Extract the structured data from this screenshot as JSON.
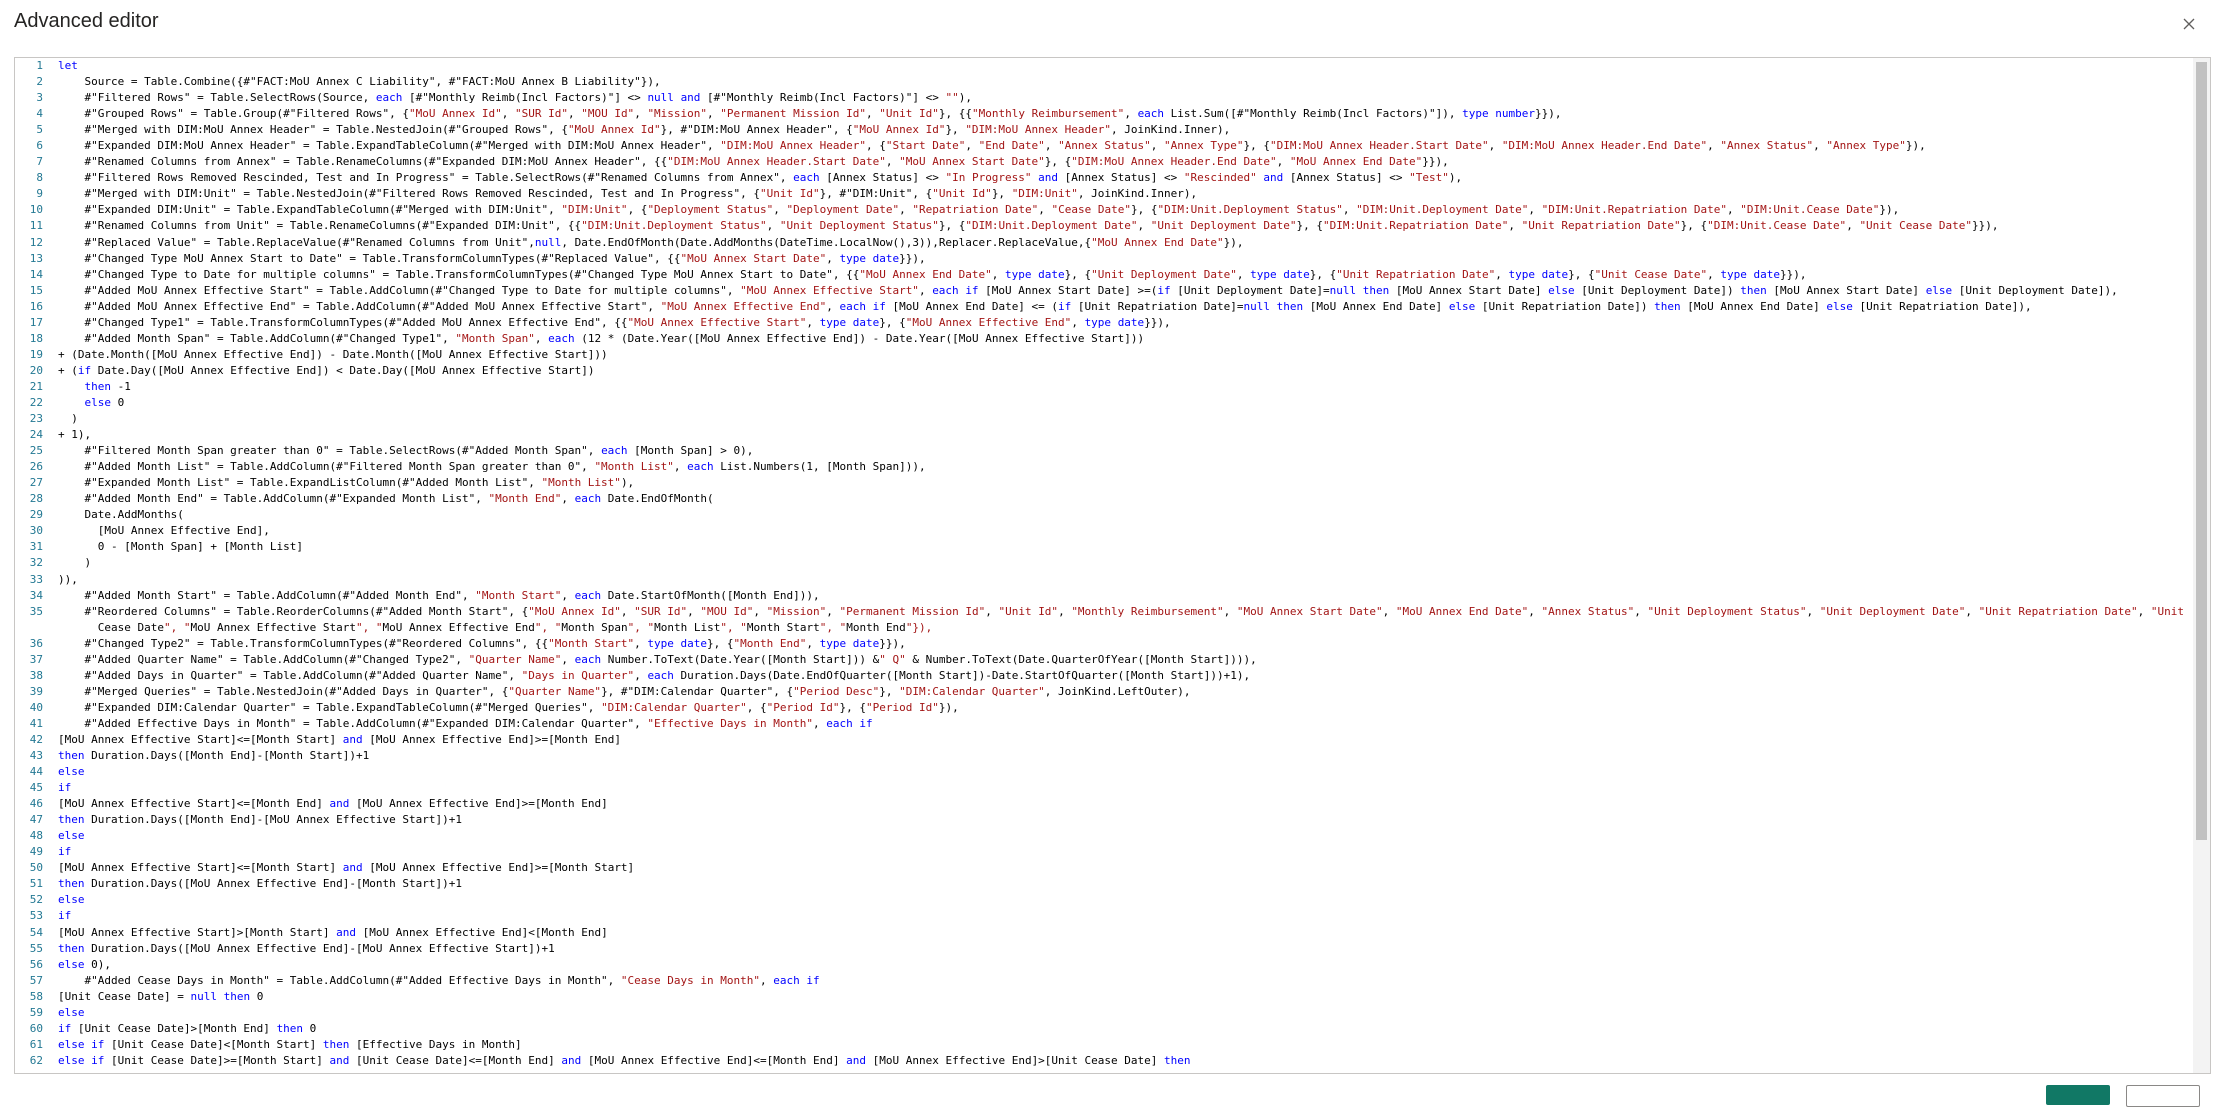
{
  "title": "Advanced editor",
  "icons": {
    "close": "close-icon"
  },
  "colors": {
    "keyword": "#0000ff",
    "string": "#a31515",
    "line_number": "#237893",
    "accent": "#117865"
  },
  "buttons": {
    "done_label": "",
    "cancel_label": ""
  },
  "editor": {
    "lines": [
      "let",
      "    Source = Table.Combine({#\"FACT:MoU Annex C Liability\", #\"FACT:MoU Annex B Liability\"}),",
      "    #\"Filtered Rows\" = Table.SelectRows(Source, each [#\"Monthly Reimb(Incl Factors)\"] <> null and [#\"Monthly Reimb(Incl Factors)\"] <> \"\"),",
      "    #\"Grouped Rows\" = Table.Group(#\"Filtered Rows\", {\"MoU Annex Id\", \"SUR Id\", \"MOU Id\", \"Mission\", \"Permanent Mission Id\", \"Unit Id\"}, {{\"Monthly Reimbursement\", each List.Sum([#\"Monthly Reimb(Incl Factors)\"]), type number}}),",
      "    #\"Merged with DIM:MoU Annex Header\" = Table.NestedJoin(#\"Grouped Rows\", {\"MoU Annex Id\"}, #\"DIM:MoU Annex Header\", {\"MoU Annex Id\"}, \"DIM:MoU Annex Header\", JoinKind.Inner),",
      "    #\"Expanded DIM:MoU Annex Header\" = Table.ExpandTableColumn(#\"Merged with DIM:MoU Annex Header\", \"DIM:MoU Annex Header\", {\"Start Date\", \"End Date\", \"Annex Status\", \"Annex Type\"}, {\"DIM:MoU Annex Header.Start Date\", \"DIM:MoU Annex Header.End Date\", \"Annex Status\", \"Annex Type\"}),",
      "    #\"Renamed Columns from Annex\" = Table.RenameColumns(#\"Expanded DIM:MoU Annex Header\", {{\"DIM:MoU Annex Header.Start Date\", \"MoU Annex Start Date\"}, {\"DIM:MoU Annex Header.End Date\", \"MoU Annex End Date\"}}),",
      "    #\"Filtered Rows Removed Rescinded, Test and In Progress\" = Table.SelectRows(#\"Renamed Columns from Annex\", each [Annex Status] <> \"In Progress\" and [Annex Status] <> \"Rescinded\" and [Annex Status] <> \"Test\"),",
      "    #\"Merged with DIM:Unit\" = Table.NestedJoin(#\"Filtered Rows Removed Rescinded, Test and In Progress\", {\"Unit Id\"}, #\"DIM:Unit\", {\"Unit Id\"}, \"DIM:Unit\", JoinKind.Inner),",
      "    #\"Expanded DIM:Unit\" = Table.ExpandTableColumn(#\"Merged with DIM:Unit\", \"DIM:Unit\", {\"Deployment Status\", \"Deployment Date\", \"Repatriation Date\", \"Cease Date\"}, {\"DIM:Unit.Deployment Status\", \"DIM:Unit.Deployment Date\", \"DIM:Unit.Repatriation Date\", \"DIM:Unit.Cease Date\"}),",
      "    #\"Renamed Columns from Unit\" = Table.RenameColumns(#\"Expanded DIM:Unit\", {{\"DIM:Unit.Deployment Status\", \"Unit Deployment Status\"}, {\"DIM:Unit.Deployment Date\", \"Unit Deployment Date\"}, {\"DIM:Unit.Repatriation Date\", \"Unit Repatriation Date\"}, {\"DIM:Unit.Cease Date\", \"Unit Cease Date\"}}),",
      "    #\"Replaced Value\" = Table.ReplaceValue(#\"Renamed Columns from Unit\",null, Date.EndOfMonth(Date.AddMonths(DateTime.LocalNow(),3)),Replacer.ReplaceValue,{\"MoU Annex End Date\"}),",
      "    #\"Changed Type MoU Annex Start to Date\" = Table.TransformColumnTypes(#\"Replaced Value\", {{\"MoU Annex Start Date\", type date}}),",
      "    #\"Changed Type to Date for multiple columns\" = Table.TransformColumnTypes(#\"Changed Type MoU Annex Start to Date\", {{\"MoU Annex End Date\", type date}, {\"Unit Deployment Date\", type date}, {\"Unit Repatriation Date\", type date}, {\"Unit Cease Date\", type date}}),",
      "    #\"Added MoU Annex Effective Start\" = Table.AddColumn(#\"Changed Type to Date for multiple columns\", \"MoU Annex Effective Start\", each if [MoU Annex Start Date] >=(if [Unit Deployment Date]=null then [MoU Annex Start Date] else [Unit Deployment Date]) then [MoU Annex Start Date] else [Unit Deployment Date]),",
      "    #\"Added MoU Annex Effective End\" = Table.AddColumn(#\"Added MoU Annex Effective Start\", \"MoU Annex Effective End\", each if [MoU Annex End Date] <= (if [Unit Repatriation Date]=null then [MoU Annex End Date] else [Unit Repatriation Date]) then [MoU Annex End Date] else [Unit Repatriation Date]),",
      "    #\"Changed Type1\" = Table.TransformColumnTypes(#\"Added MoU Annex Effective End\", {{\"MoU Annex Effective Start\", type date}, {\"MoU Annex Effective End\", type date}}),",
      "    #\"Added Month Span\" = Table.AddColumn(#\"Changed Type1\", \"Month Span\", each (12 * (Date.Year([MoU Annex Effective End]) - Date.Year([MoU Annex Effective Start]))",
      "+ (Date.Month([MoU Annex Effective End]) - Date.Month([MoU Annex Effective Start]))",
      "+ (if Date.Day([MoU Annex Effective End]) < Date.Day([MoU Annex Effective Start])",
      "    then -1",
      "    else 0",
      "  )",
      "+ 1),",
      "    #\"Filtered Month Span greater than 0\" = Table.SelectRows(#\"Added Month Span\", each [Month Span] > 0),",
      "    #\"Added Month List\" = Table.AddColumn(#\"Filtered Month Span greater than 0\", \"Month List\", each List.Numbers(1, [Month Span])),",
      "    #\"Expanded Month List\" = Table.ExpandListColumn(#\"Added Month List\", \"Month List\"),",
      "    #\"Added Month End\" = Table.AddColumn(#\"Expanded Month List\", \"Month End\", each Date.EndOfMonth(",
      "    Date.AddMonths(",
      "      [MoU Annex Effective End],",
      "      0 - [Month Span] + [Month List]",
      "    )",
      ")),",
      "    #\"Added Month Start\" = Table.AddColumn(#\"Added Month End\", \"Month Start\", each Date.StartOfMonth([Month End])),",
      "    #\"Reordered Columns\" = Table.ReorderColumns(#\"Added Month Start\", {\"MoU Annex Id\", \"SUR Id\", \"MOU Id\", \"Mission\", \"Permanent Mission Id\", \"Unit Id\", \"Monthly Reimbursement\", \"MoU Annex Start Date\", \"MoU Annex End Date\", \"Annex Status\", \"Unit Deployment Status\", \"Unit Deployment Date\", \"Unit Repatriation Date\", \"Unit",
      "    #\"Changed Type2\" = Table.TransformColumnTypes(#\"Reordered Columns\", {{\"Month Start\", type date}, {\"Month End\", type date}}),",
      "    #\"Added Quarter Name\" = Table.AddColumn(#\"Changed Type2\", \"Quarter Name\", each Number.ToText(Date.Year([Month Start])) &\" Q\" & Number.ToText(Date.QuarterOfYear([Month Start]))),",
      "    #\"Added Days in Quarter\" = Table.AddColumn(#\"Added Quarter Name\", \"Days in Quarter\", each Duration.Days(Date.EndOfQuarter([Month Start])-Date.StartOfQuarter([Month Start]))+1),",
      "    #\"Merged Queries\" = Table.NestedJoin(#\"Added Days in Quarter\", {\"Quarter Name\"}, #\"DIM:Calendar Quarter\", {\"Period Desc\"}, \"DIM:Calendar Quarter\", JoinKind.LeftOuter),",
      "    #\"Expanded DIM:Calendar Quarter\" = Table.ExpandTableColumn(#\"Merged Queries\", \"DIM:Calendar Quarter\", {\"Period Id\"}, {\"Period Id\"}),",
      "    #\"Added Effective Days in Month\" = Table.AddColumn(#\"Expanded DIM:Calendar Quarter\", \"Effective Days in Month\", each if",
      "[MoU Annex Effective Start]<=[Month Start] and [MoU Annex Effective End]>=[Month End]",
      "then Duration.Days([Month End]-[Month Start])+1",
      "else",
      "if",
      "[MoU Annex Effective Start]<=[Month End] and [MoU Annex Effective End]>=[Month End]",
      "then Duration.Days([Month End]-[MoU Annex Effective Start])+1",
      "else",
      "if",
      "[MoU Annex Effective Start]<=[Month Start] and [MoU Annex Effective End]>=[Month Start]",
      "then Duration.Days([MoU Annex Effective End]-[Month Start])+1",
      "else",
      "if",
      "[MoU Annex Effective Start]>[Month Start] and [MoU Annex Effective End]<[Month End]",
      "then Duration.Days([MoU Annex Effective End]-[MoU Annex Effective Start])+1",
      "else 0),",
      "    #\"Added Cease Days in Month\" = Table.AddColumn(#\"Added Effective Days in Month\", \"Cease Days in Month\", each if",
      "[Unit Cease Date] = null then 0",
      "else",
      "if [Unit Cease Date]>[Month End] then 0",
      "else if [Unit Cease Date]<[Month Start] then [Effective Days in Month]",
      "else if [Unit Cease Date]>=[Month Start] and [Unit Cease Date]<=[Month End] and [MoU Annex Effective End]<=[Month End] and [MoU Annex Effective End]>[Unit Cease Date] then"
    ],
    "line_numbers": [
      "1",
      "2",
      "3",
      "4",
      "5",
      "6",
      "7",
      "8",
      "9",
      "10",
      "11",
      "12",
      "13",
      "14",
      "15",
      "16",
      "17",
      "18",
      "19",
      "20",
      "21",
      "22",
      "23",
      "24",
      "25",
      "26",
      "27",
      "28",
      "29",
      "30",
      "31",
      "32",
      "33",
      "34",
      "35",
      "",
      "36",
      "37",
      "38",
      "39",
      "40",
      "41",
      "42",
      "43",
      "44",
      "45",
      "46",
      "47",
      "48",
      "49",
      "50",
      "51",
      "52",
      "53",
      "54",
      "55",
      "56",
      "57",
      "58",
      "59",
      "60",
      "61",
      "62"
    ]
  }
}
